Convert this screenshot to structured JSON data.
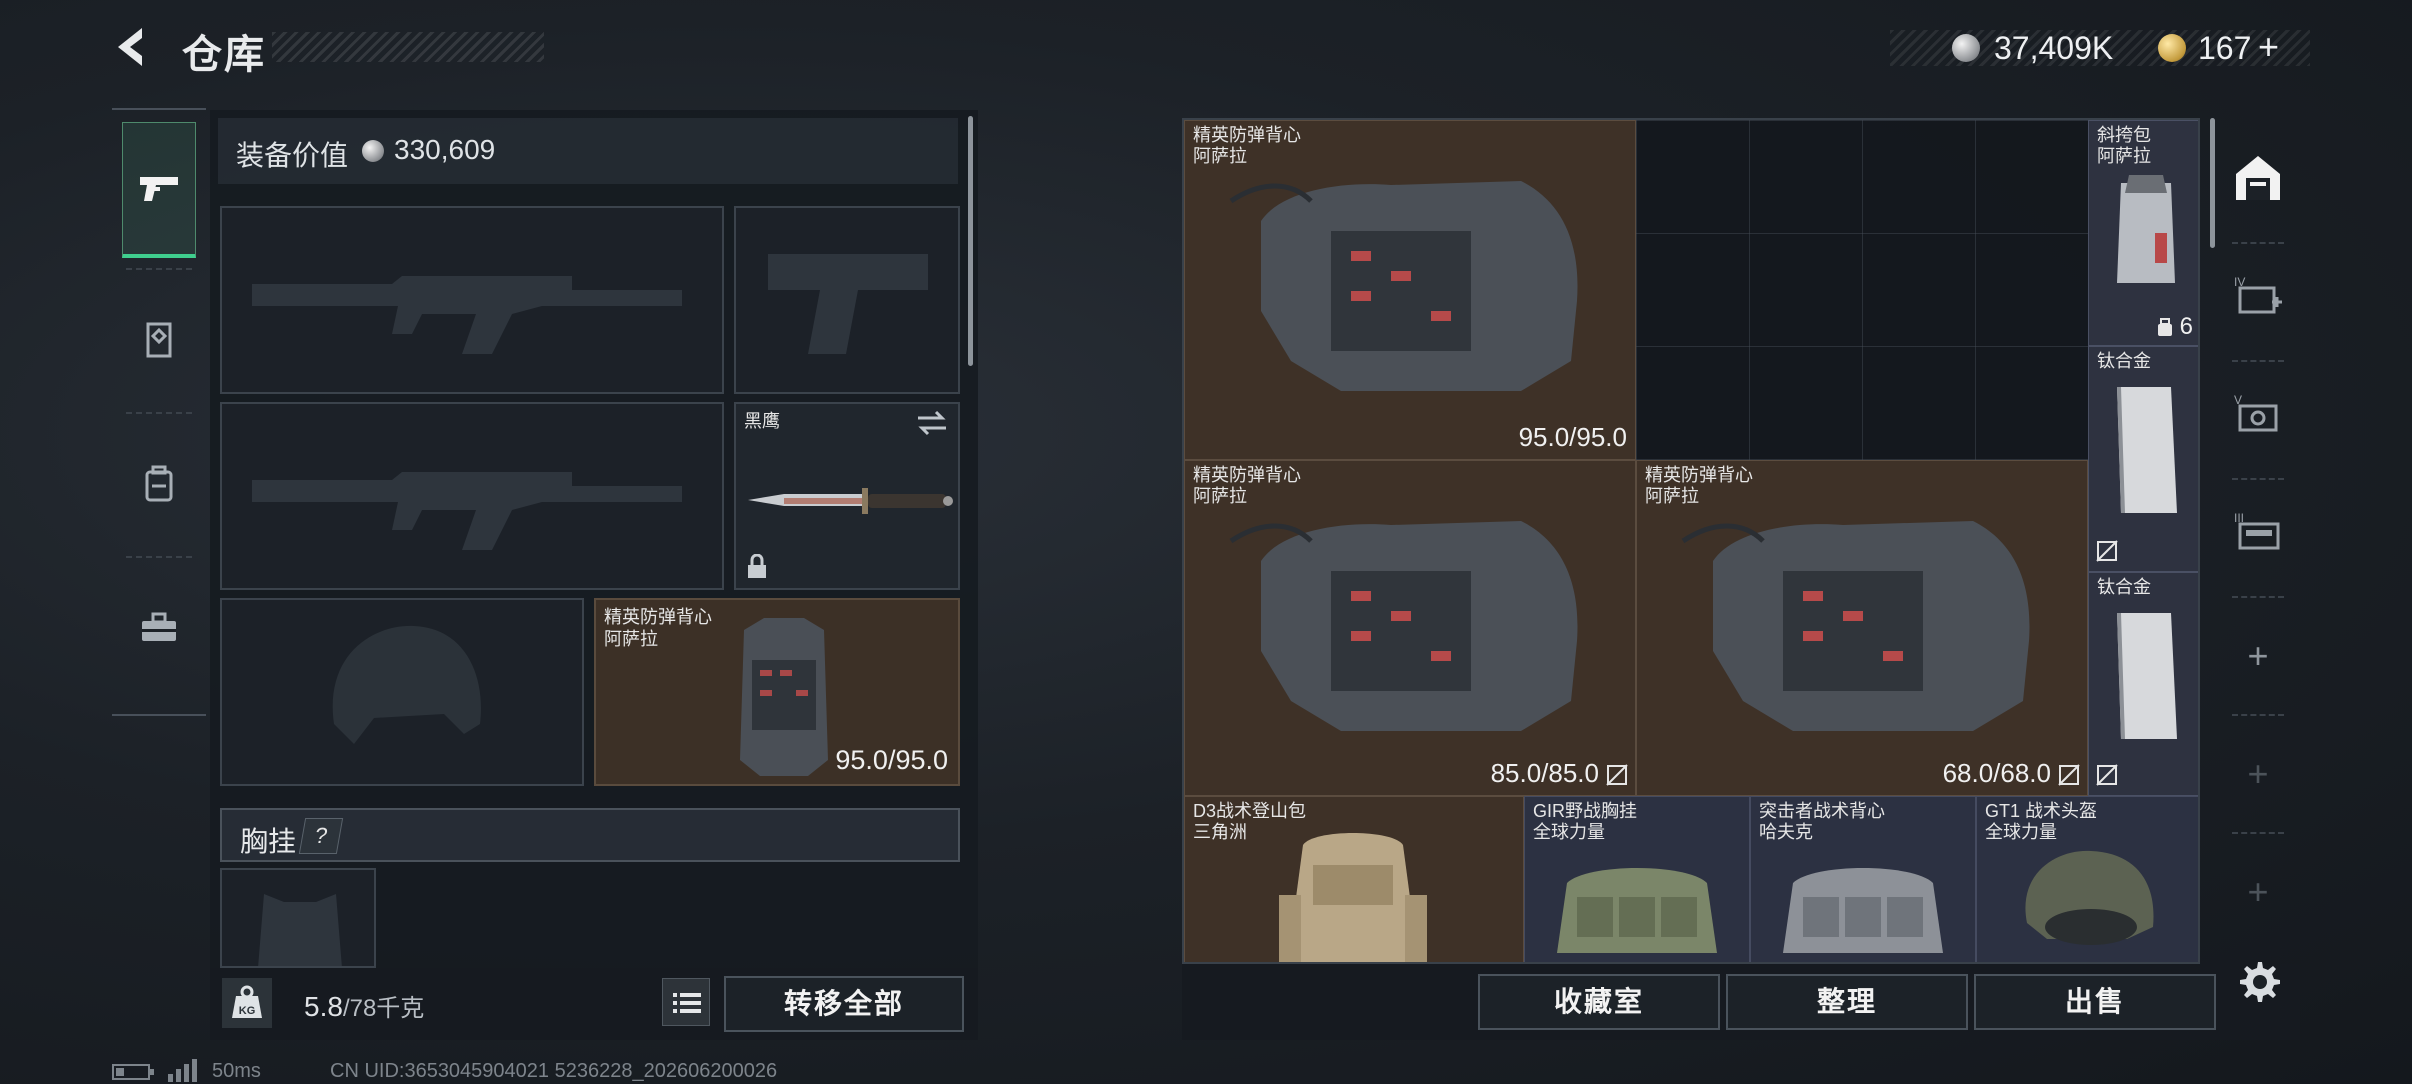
{
  "header": {
    "title": "仓库",
    "currency_silver": "37,409K",
    "currency_gold": "167",
    "add_label": "+"
  },
  "left_rail": {
    "icons": [
      "pistol-icon",
      "armor-plate-icon",
      "backpack-icon",
      "toolbox-icon"
    ],
    "active_index": 0
  },
  "equipment": {
    "value_label": "装备价值",
    "value_amount": "330,609",
    "melee": {
      "name": "黑鹰"
    },
    "armor": {
      "name": "精英防弹背心",
      "brand": "阿萨拉",
      "durability": "95.0/95.0"
    },
    "chest_rig_label": "胸挂",
    "help_label": "?"
  },
  "footer_left": {
    "weight": "5.8",
    "weight_max": "/78千克",
    "weight_icon_text": "KG",
    "transfer_all": "转移全部"
  },
  "storage": {
    "items": [
      {
        "name": "精英防弹背心",
        "brand": "阿萨拉",
        "durability": "95.0/95.0"
      },
      {
        "name": "精英防弹背心",
        "brand": "阿萨拉",
        "durability": "85.0/85.0"
      },
      {
        "name": "精英防弹背心",
        "brand": "阿萨拉",
        "durability": "68.0/68.0"
      },
      {
        "name": "D3战术登山包",
        "brand": "三角洲"
      },
      {
        "name": "GIR野战胸挂",
        "brand": "全球力量"
      },
      {
        "name": "突击者战术背心",
        "brand": "哈夫克"
      },
      {
        "name": "GT1 战术头盔",
        "brand": "全球力量"
      }
    ],
    "side_items": [
      {
        "name": "斜挎包",
        "brand": "阿萨拉",
        "count": "6"
      },
      {
        "name": "钛合金"
      },
      {
        "name": "钛合金"
      }
    ]
  },
  "footer_right": {
    "collection": "收藏室",
    "organize": "整理",
    "sell": "出售"
  },
  "status": {
    "ping": "50ms",
    "uid": "CN UID:3653045904021 5236228_202606200026"
  },
  "colors": {
    "accent_green": "#3fcf8e",
    "item_brown": "#3e3127",
    "item_blue": "#2c3142"
  }
}
